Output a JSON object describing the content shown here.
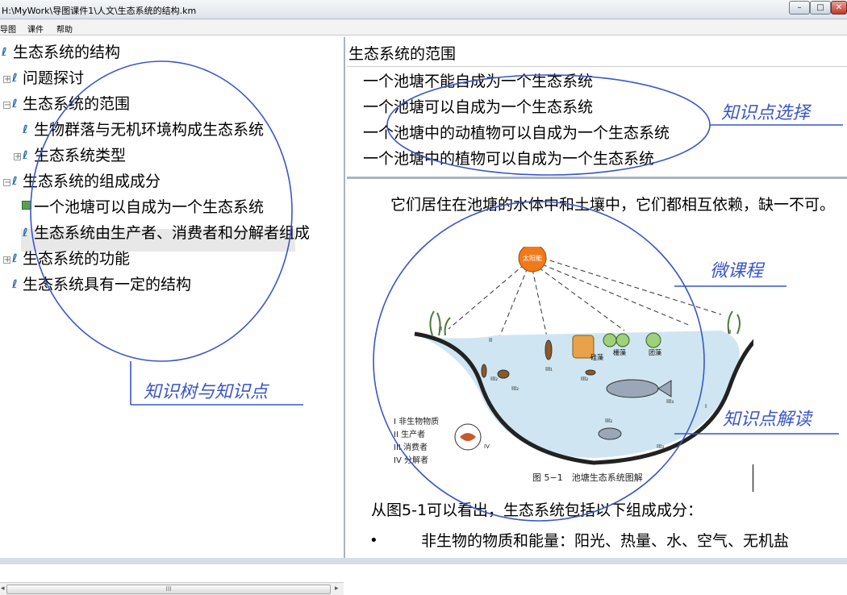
{
  "window": {
    "title": "H:\\MyWork\\导图课件1\\人文\\生态系统的结构.km",
    "min": "–",
    "max": "□",
    "close": "✕"
  },
  "menu": [
    "导图",
    "课件",
    "帮助"
  ],
  "tree": [
    "生态系统的结构",
    "问题探讨",
    "生态系统的范围",
    "生物群落与无机环境构成生态系统",
    "生态系统类型",
    "生态系统的组成成分",
    "一个池塘可以自成为一个生态系统",
    "生态系统由生产者、消费者和分解者组成",
    "生态系统的功能",
    "生态系统具有一定的结构"
  ],
  "scroll_grip": "III",
  "options": {
    "title": "生态系统的范围",
    "items": [
      "一个池塘不能自成为一个生态系统",
      "一个池塘可以自成为一个生态系统",
      "一个池塘中的动植物可以自成为一个生态系统",
      "一个池塘中的植物可以自成为一个生态系统"
    ]
  },
  "content": {
    "paragraph": "它们居住在池塘的水体中和土壤中，它们都相互依赖，缺一不可。",
    "figure": {
      "sun": "太阳能",
      "labels": [
        "硅藻",
        "栅藻",
        "团藻"
      ],
      "roman": [
        "II",
        "II",
        "II",
        "III₁",
        "III₂",
        "III₂",
        "III₃",
        "III₂",
        "III₃",
        "I",
        "IV",
        "III₂"
      ],
      "legend": [
        "I 非生物物质",
        "II 生产者",
        "III 消费者",
        "IV 分解者"
      ],
      "caption": "图 5−1　池塘生态系统图解"
    },
    "sentence": "从图5-1可以看出，生态系统包括以下组成成分：",
    "bullet": "•",
    "bullet_text": "非生物的物质和能量：阳光、热量、水、空气、无机盐"
  },
  "annotations": {
    "tree": "知识树与知识点",
    "choice": "知识点选择",
    "micro": "微课程",
    "reading": "知识点解读"
  },
  "colors": {
    "annotation": "#3a55c8",
    "leaf_icon": "#2a6db5",
    "sun": "#f07a1a",
    "water": "#cfe6f2"
  }
}
